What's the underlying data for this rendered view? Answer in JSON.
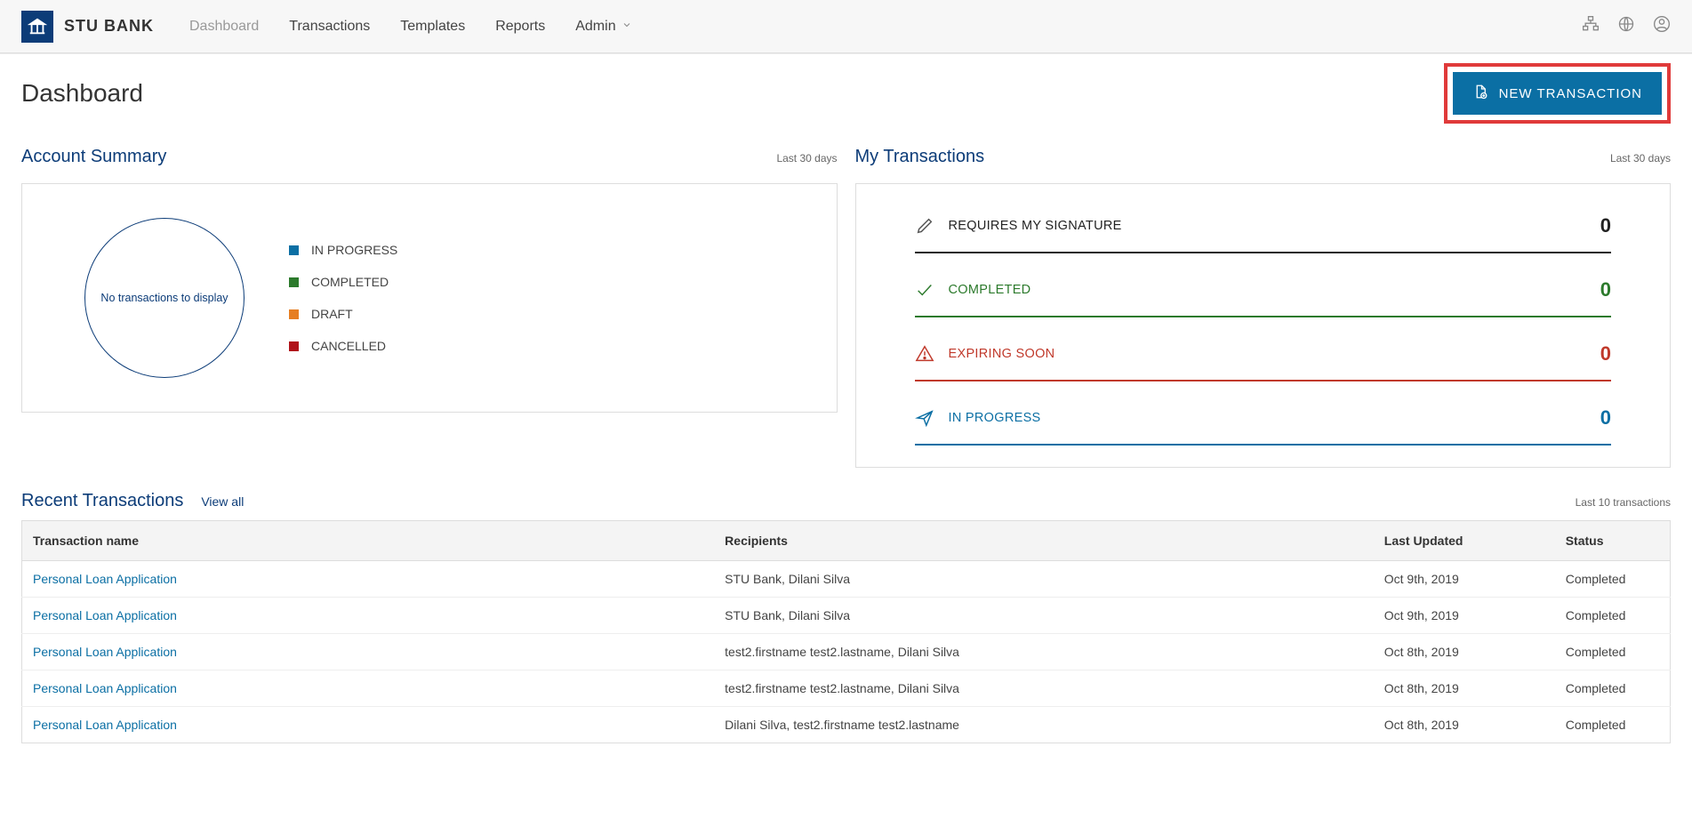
{
  "brand": {
    "name": "STU BANK"
  },
  "nav": {
    "items": [
      {
        "label": "Dashboard",
        "active": true
      },
      {
        "label": "Transactions",
        "active": false
      },
      {
        "label": "Templates",
        "active": false
      },
      {
        "label": "Reports",
        "active": false
      },
      {
        "label": "Admin",
        "active": false,
        "dropdown": true
      }
    ]
  },
  "page_title": "Dashboard",
  "new_transaction_label": "NEW TRANSACTION",
  "account_summary": {
    "title": "Account Summary",
    "period": "Last 30 days",
    "empty_text": "No transactions to display",
    "legend": [
      {
        "label": "IN PROGRESS",
        "color": "#0b6fa4"
      },
      {
        "label": "COMPLETED",
        "color": "#2c7a2c"
      },
      {
        "label": "DRAFT",
        "color": "#e67e22"
      },
      {
        "label": "CANCELLED",
        "color": "#b0121a"
      }
    ]
  },
  "my_transactions": {
    "title": "My Transactions",
    "period": "Last 30 days",
    "metrics": {
      "signature": {
        "label": "REQUIRES MY SIGNATURE",
        "value": "0"
      },
      "completed": {
        "label": "COMPLETED",
        "value": "0"
      },
      "expiring": {
        "label": "EXPIRING SOON",
        "value": "0"
      },
      "inprogress": {
        "label": "IN PROGRESS",
        "value": "0"
      }
    }
  },
  "recent": {
    "title": "Recent Transactions",
    "view_all": "View all",
    "subtitle": "Last 10 transactions",
    "columns": {
      "name": "Transaction name",
      "recipients": "Recipients",
      "updated": "Last Updated",
      "status": "Status"
    },
    "rows": [
      {
        "name": "Personal Loan Application",
        "recipients": "STU Bank, Dilani Silva",
        "updated": "Oct 9th, 2019",
        "status": "Completed"
      },
      {
        "name": "Personal Loan Application",
        "recipients": "STU Bank, Dilani Silva",
        "updated": "Oct 9th, 2019",
        "status": "Completed"
      },
      {
        "name": "Personal Loan Application",
        "recipients": "test2.firstname test2.lastname, Dilani Silva",
        "updated": "Oct 8th, 2019",
        "status": "Completed"
      },
      {
        "name": "Personal Loan Application",
        "recipients": "test2.firstname test2.lastname, Dilani Silva",
        "updated": "Oct 8th, 2019",
        "status": "Completed"
      },
      {
        "name": "Personal Loan Application",
        "recipients": "Dilani Silva, test2.firstname test2.lastname",
        "updated": "Oct 8th, 2019",
        "status": "Completed"
      }
    ]
  },
  "chart_data": {
    "type": "pie",
    "title": "Account Summary",
    "categories": [
      "IN PROGRESS",
      "COMPLETED",
      "DRAFT",
      "CANCELLED"
    ],
    "values": [
      0,
      0,
      0,
      0
    ],
    "note": "No transactions to display"
  }
}
